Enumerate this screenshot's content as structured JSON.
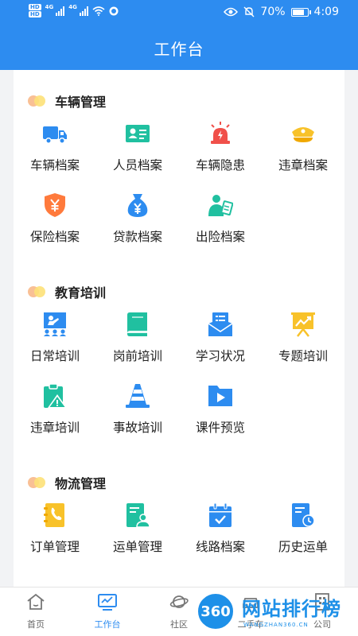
{
  "status_bar": {
    "hd1": "HD",
    "hd2": "HD",
    "net1": "4G",
    "net2": "4G",
    "battery": "70%",
    "time": "4:09"
  },
  "header": {
    "title": "工作台"
  },
  "sections": [
    {
      "title": "车辆管理",
      "items": [
        {
          "label": "车辆档案",
          "icon": "truck-icon"
        },
        {
          "label": "人员档案",
          "icon": "id-card-icon"
        },
        {
          "label": "车辆隐患",
          "icon": "alarm-light-icon"
        },
        {
          "label": "违章档案",
          "icon": "police-cap-icon"
        },
        {
          "label": "保险档案",
          "icon": "insurance-shield-icon"
        },
        {
          "label": "贷款档案",
          "icon": "money-bag-icon"
        },
        {
          "label": "出险档案",
          "icon": "person-report-icon"
        }
      ]
    },
    {
      "title": "教育培训",
      "items": [
        {
          "label": "日常培训",
          "icon": "presentation-icon"
        },
        {
          "label": "岗前培训",
          "icon": "book-icon"
        },
        {
          "label": "学习状况",
          "icon": "inbox-list-icon"
        },
        {
          "label": "专题培训",
          "icon": "trend-board-icon"
        },
        {
          "label": "违章培训",
          "icon": "clipboard-warning-icon"
        },
        {
          "label": "事故培训",
          "icon": "traffic-cone-icon"
        },
        {
          "label": "课件预览",
          "icon": "video-folder-icon"
        }
      ]
    },
    {
      "title": "物流管理",
      "items": [
        {
          "label": "订单管理",
          "icon": "contact-book-icon"
        },
        {
          "label": "运单管理",
          "icon": "waybill-user-icon"
        },
        {
          "label": "线路档案",
          "icon": "calendar-check-icon"
        },
        {
          "label": "历史运单",
          "icon": "history-doc-icon"
        }
      ]
    }
  ],
  "tabbar": [
    {
      "label": "首页",
      "icon": "home-icon",
      "active": false
    },
    {
      "label": "工作台",
      "icon": "monitor-icon",
      "active": true
    },
    {
      "label": "社区",
      "icon": "planet-icon",
      "active": false
    },
    {
      "label": "二手车",
      "icon": "car-icon",
      "active": false
    },
    {
      "label": "公司",
      "icon": "building-icon",
      "active": false
    }
  ],
  "watermark": {
    "circle": "360",
    "text": "网站排行榜",
    "sub": "WANGZHAN360.CN"
  },
  "colors": {
    "primary": "#2d8cf0",
    "green": "#20c0a0",
    "orange": "#ff7a3c",
    "red": "#f0504a",
    "yellow": "#f8c22a"
  }
}
